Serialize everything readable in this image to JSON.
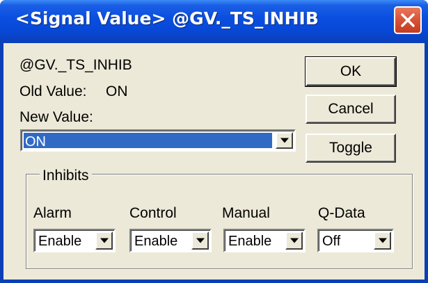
{
  "window": {
    "title": "<Signal Value> @GV._TS_INHIB"
  },
  "signal": {
    "name": "@GV._TS_INHIB",
    "old_value_label": "Old Value:",
    "old_value": "ON",
    "new_value_label": "New Value:",
    "new_value": "ON"
  },
  "buttons": {
    "ok": "OK",
    "cancel": "Cancel",
    "toggle": "Toggle"
  },
  "inhibits": {
    "group_label": "Inhibits",
    "columns": [
      {
        "label": "Alarm",
        "value": "Enable"
      },
      {
        "label": "Control",
        "value": "Enable"
      },
      {
        "label": "Manual",
        "value": "Enable"
      },
      {
        "label": "Q-Data",
        "value": "Off"
      }
    ]
  },
  "icons": {
    "close": "close-icon",
    "dropdown": "chevron-down-icon"
  },
  "colors": {
    "titlebar": "#0a4fe0",
    "selection": "#316ac5",
    "dialog_face": "#ece9d8",
    "close_button": "#d9553a"
  }
}
